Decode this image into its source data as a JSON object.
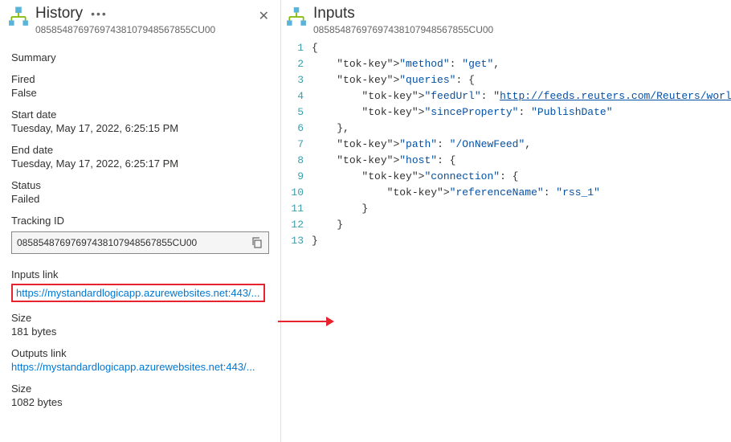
{
  "history": {
    "title": "History",
    "id": "08585487697697438107948567855CU00",
    "summary_label": "Summary",
    "fired_label": "Fired",
    "fired_value": "False",
    "start_label": "Start date",
    "start_value": "Tuesday, May 17, 2022, 6:25:15 PM",
    "end_label": "End date",
    "end_value": "Tuesday, May 17, 2022, 6:25:17 PM",
    "status_label": "Status",
    "status_value": "Failed",
    "tracking_label": "Tracking ID",
    "tracking_value": "08585487697697438107948567855CU00",
    "inputs_link_label": "Inputs link",
    "inputs_link": "https://mystandardlogicapp.azurewebsites.net:443/...",
    "inputs_size_label": "Size",
    "inputs_size_value": "181 bytes",
    "outputs_link_label": "Outputs link",
    "outputs_link": "https://mystandardlogicapp.azurewebsites.net:443/...",
    "outputs_size_label": "Size",
    "outputs_size_value": "1082 bytes"
  },
  "inputs": {
    "title": "Inputs",
    "id": "08585487697697438107948567855CU00",
    "json": {
      "method": "get",
      "queries": {
        "feedUrl": "http://feeds.reuters.com/Reuters/worldNews",
        "sinceProperty": "PublishDate"
      },
      "path": "/OnNewFeed",
      "host": {
        "connection": {
          "referenceName": "rss_1"
        }
      }
    },
    "code_lines": [
      "{",
      "    \"method\": \"get\",",
      "    \"queries\": {",
      "        \"feedUrl\": \"http://feeds.reuters.com/Reuters/worldNews\",",
      "        \"sinceProperty\": \"PublishDate\"",
      "    },",
      "    \"path\": \"/OnNewFeed\",",
      "    \"host\": {",
      "        \"connection\": {",
      "            \"referenceName\": \"rss_1\"",
      "        }",
      "    }",
      "}"
    ]
  }
}
